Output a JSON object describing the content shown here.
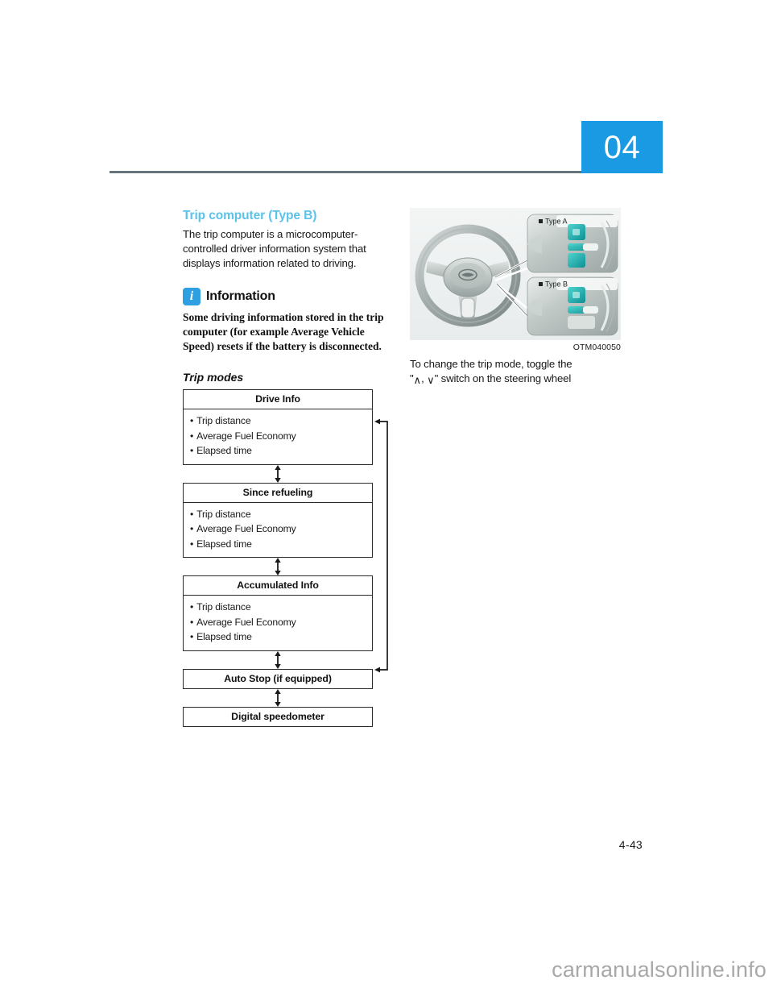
{
  "page": {
    "chapter_number": "04",
    "page_number": "4-43",
    "watermark": "carmanualsonline.info",
    "accent_color": "#5bc2e8",
    "chapter_tab_color": "#1b9ae4",
    "rule_color": "#64747a"
  },
  "left_column": {
    "heading": "Trip computer (Type B)",
    "intro": "The trip computer is a microcomputer-controlled driver information system that displays information related to driving.",
    "information": {
      "icon": "info-icon",
      "title": "Information",
      "body": "Some driving information stored in the trip computer (for example Average Vehicle Speed) resets if the battery is disconnected."
    },
    "trip_modes": {
      "heading": "Trip modes",
      "nodes": [
        {
          "title": "Drive Info",
          "items": [
            "Trip distance",
            "Average Fuel Economy",
            "Elapsed time"
          ]
        },
        {
          "title": "Since refueling",
          "items": [
            "Trip distance",
            "Average Fuel Economy",
            "Elapsed time"
          ]
        },
        {
          "title": "Accumulated Info",
          "items": [
            "Trip distance",
            "Average Fuel Economy",
            "Elapsed time"
          ]
        },
        {
          "title": "Auto Stop (if equipped)",
          "items": []
        },
        {
          "title": "Digital speedometer",
          "items": []
        }
      ]
    }
  },
  "right_column": {
    "figure": {
      "alt": "Steering wheel with callouts to Type A and Type B remote control switch panels",
      "label_type_a": "Type A",
      "label_type_b": "Type B",
      "image_id": "OTM040050"
    },
    "caption_line1": "To change the trip mode, toggle the",
    "caption_line2_prefix": "\"",
    "caption_up_symbol": "∧",
    "caption_separator": ", ",
    "caption_down_symbol": "∨",
    "caption_line2_suffix": "\" switch on the steering wheel"
  }
}
